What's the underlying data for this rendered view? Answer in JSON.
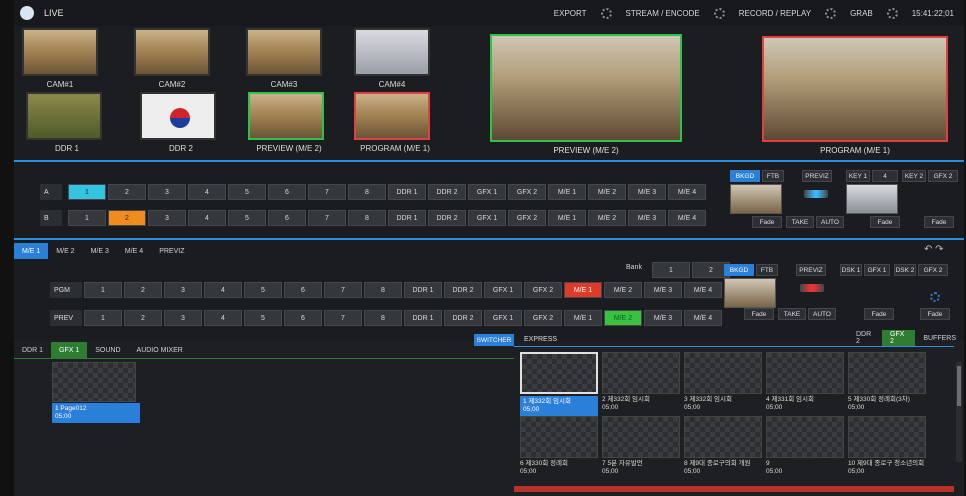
{
  "app": {
    "title": "LIVE",
    "clock": "15:41:22;01"
  },
  "topmenu": [
    "EXPORT",
    "STREAM / ENCODE",
    "RECORD / REPLAY",
    "GRAB"
  ],
  "multiview": {
    "labels": [
      "CAM#1",
      "CAM#2",
      "CAM#3",
      "CAM#4",
      "DDR 1",
      "DDR 2",
      "PREVIEW (M/E 2)",
      "PROGRAM (M/E 1)"
    ],
    "big_preview": "PREVIEW (M/E 2)",
    "big_program": "PROGRAM (M/E 1)"
  },
  "me_top": {
    "rowA": "A",
    "rowB": "B",
    "buttons": [
      "1",
      "2",
      "3",
      "4",
      "5",
      "6",
      "7",
      "8",
      "DDR 1",
      "DDR 2",
      "GFX 1",
      "GFX 2",
      "M/E 1",
      "M/E 2",
      "M/E 3",
      "M/E 4"
    ],
    "bkgd": "BKGD",
    "ftb": "FTB",
    "previz": "PREVIZ",
    "take": "TAKE",
    "auto": "AUTO",
    "fade": "Fade",
    "key1": "KEY 1",
    "key1_val": "4",
    "key2": "KEY 2",
    "key2_val": "GFX 2"
  },
  "tabs": [
    "M/E 1",
    "M/E 2",
    "M/E 3",
    "M/E 4",
    "PREVIZ"
  ],
  "me_main": {
    "pgm": "PGM",
    "prev": "PREV",
    "bank_label": "Bank",
    "bank": [
      "1",
      "2"
    ],
    "buttons": [
      "1",
      "2",
      "3",
      "4",
      "5",
      "6",
      "7",
      "8",
      "DDR 1",
      "DDR 2",
      "GFX 1",
      "GFX 2",
      "M/E 1",
      "M/E 2",
      "M/E 3",
      "M/E 4"
    ],
    "bkgd": "BKGD",
    "ftb": "FTB",
    "previz": "PREVIZ",
    "take": "TAKE",
    "auto": "AUTO",
    "fade": "Fade",
    "dsk1": "DSK 1",
    "dsk1_val": "GFX 1",
    "dsk2": "DSK 2",
    "dsk2_val": "GFX 2"
  },
  "bottom": {
    "left_tabs": [
      "DDR 1",
      "GFX 1",
      "SOUND",
      "AUDIO MIXER"
    ],
    "switcher": "SWITCHER",
    "express": "EXPRESS",
    "right_tabs": [
      "DDR 2",
      "GFX 2",
      "BUFFERS"
    ],
    "left_item": {
      "name": "1 Page012",
      "time": "05;00"
    },
    "items": [
      {
        "num": "1",
        "name": "제332회 임시회",
        "time": "05;00"
      },
      {
        "num": "2",
        "name": "제332회 임시회",
        "time": "05;00"
      },
      {
        "num": "3",
        "name": "제332회 임시회",
        "time": "05;00"
      },
      {
        "num": "4",
        "name": "제331회 임시회",
        "time": "05;00"
      },
      {
        "num": "5",
        "name": "제330회 정례회(3차)",
        "time": "05;00"
      },
      {
        "num": "6",
        "name": "제330회 정례회",
        "time": "05;00"
      },
      {
        "num": "7",
        "name": "5분 자유발언",
        "time": "05;00"
      },
      {
        "num": "8",
        "name": "제9대 종로구의회 개원",
        "time": "05;00"
      },
      {
        "num": "9",
        "name": "",
        "time": "05;00"
      },
      {
        "num": "10",
        "name": "제9대 종로구 청소년의회",
        "time": "05;00"
      }
    ]
  },
  "colors": {
    "accent": "#2a7fd8",
    "program": "#e04040",
    "preview": "#2ec24a",
    "selectA": "#35c4e0",
    "selectB": "#f08b20"
  }
}
